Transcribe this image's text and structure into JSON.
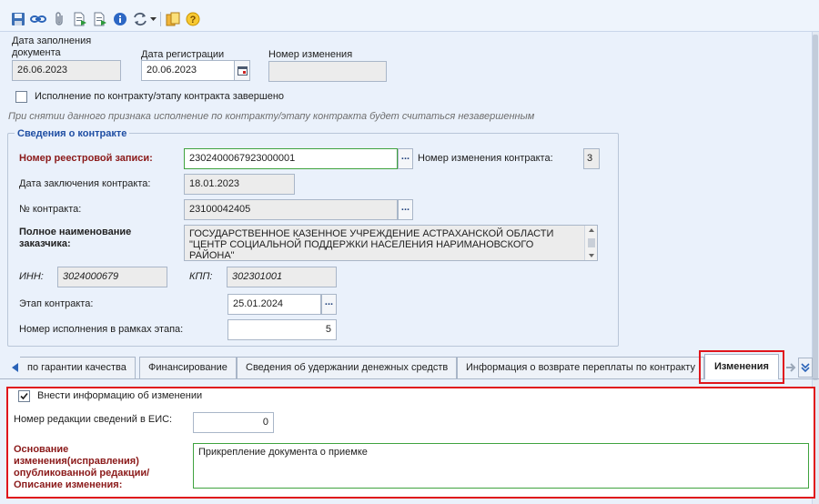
{
  "toolbar": {
    "icons": [
      "save-icon",
      "link-icon",
      "attach-icon",
      "export-doc-icon",
      "export-doc2-icon",
      "info-icon",
      "workflow-icon",
      "dropdown-arrow-icon",
      "reports-icon",
      "help-icon"
    ]
  },
  "header": {
    "fill_date_label": "Дата заполнения документа",
    "fill_date_label_l1": "Дата заполнения",
    "fill_date_label_l2": "документа",
    "fill_date_value": "26.06.2023",
    "reg_date_label": "Дата регистрации",
    "reg_date_value": "20.06.2023",
    "change_number_label": "Номер изменения",
    "change_number_value": ""
  },
  "completion": {
    "checkbox_label": "Исполнение по контракту/этапу контракта завершено",
    "checked": false,
    "hint": "При снятии данного признака исполнение по контракту/этапу контракта будет считаться незавершенным"
  },
  "contract": {
    "group_title": "Сведения о контракте",
    "registry_label": "Номер реестровой записи:",
    "registry_value": "2302400067923000001",
    "contract_change_label": "Номер изменения контракта:",
    "contract_change_value": "3",
    "conclusion_date_label": "Дата заключения контракта:",
    "conclusion_date_value": "18.01.2023",
    "contract_no_label": "№ контракта:",
    "contract_no_value": "23100042405",
    "customer_label_l1": "Полное наименование",
    "customer_label_l2": "заказчика:",
    "customer_value_l1": "ГОСУДАРСТВЕННОЕ КАЗЕННОЕ УЧРЕЖДЕНИЕ АСТРАХАНСКОЙ ОБЛАСТИ",
    "customer_value_l2": "\"ЦЕНТР СОЦИАЛЬНОЙ ПОДДЕРЖКИ НАСЕЛЕНИЯ НАРИМАНОВСКОГО",
    "customer_value_l3": "РАЙОНА\"",
    "inn_label": "ИНН:",
    "inn_value": "3024000679",
    "kpp_label": "КПП:",
    "kpp_value": "302301001",
    "stage_label": "Этап контракта:",
    "stage_value": "25.01.2024",
    "exec_no_label": "Номер исполнения в рамках этапа:",
    "exec_no_value": "5",
    "dots": "..."
  },
  "tabs": {
    "items": [
      {
        "label": "по гарантии качества"
      },
      {
        "label": "Финансирование"
      },
      {
        "label": "Сведения об удержании денежных средств"
      },
      {
        "label": "Информация о возврате переплаты по контракту"
      },
      {
        "label": "Изменения"
      }
    ],
    "active": "Изменения"
  },
  "changes": {
    "enter_info_label": "Внести информацию об изменении",
    "enter_info_checked": true,
    "eis_label": "Номер редакции сведений в ЕИС:",
    "eis_value": "0",
    "reason_label_l1": "Основание",
    "reason_label_l2": "изменения(исправления)",
    "reason_label_l3": "опубликованной редакции/",
    "reason_label_l4": "Описание изменения:",
    "reason_value": "Прикрепление документа о приемке"
  },
  "colors": {
    "accent_red": "#e0151b",
    "group_title": "#1f4ea3",
    "required_label": "#8b1a1a",
    "valid_border": "#3fa33f"
  }
}
